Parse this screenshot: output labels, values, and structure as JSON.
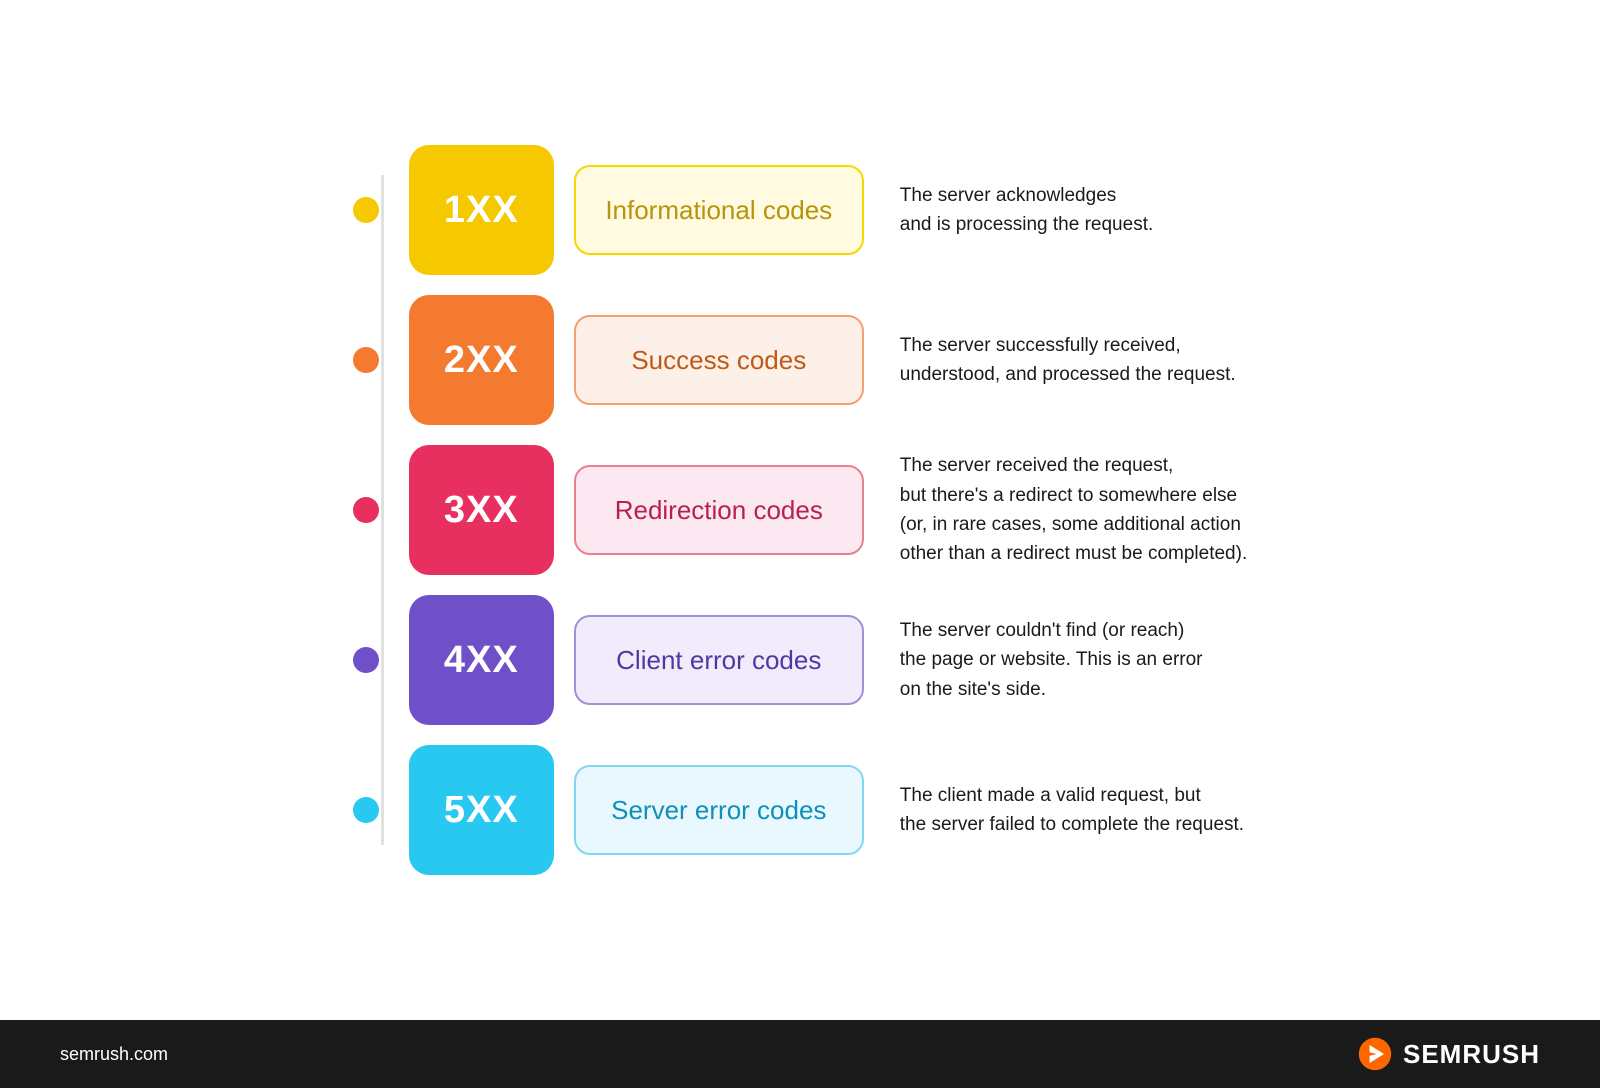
{
  "diagram": {
    "rows": [
      {
        "id": "1xx",
        "dot_color": "#f5c800",
        "code": "1XX",
        "code_bg": "#f5c800",
        "name": "Informational codes",
        "name_bg": "#fffae0",
        "name_border": "#f5d800",
        "name_color": "#b8940a",
        "description": "The server acknowledges\nand is processing the request."
      },
      {
        "id": "2xx",
        "dot_color": "#f47a30",
        "code": "2XX",
        "code_bg": "#f47a30",
        "name": "Success codes",
        "name_bg": "#fdf0e8",
        "name_border": "#f4a070",
        "name_color": "#c05a18",
        "description": "The server successfully received,\nunderstood, and processed the request."
      },
      {
        "id": "3xx",
        "dot_color": "#e83060",
        "code": "3XX",
        "code_bg": "#e83060",
        "name": "Redirection codes",
        "name_bg": "#fce8f0",
        "name_border": "#e88090",
        "name_color": "#b82050",
        "description": "The server received the request,\nbut there's a redirect to somewhere else\n(or, in rare cases, some additional action\nother than a redirect must be completed)."
      },
      {
        "id": "4xx",
        "dot_color": "#7050c8",
        "code": "4XX",
        "code_bg": "#7050c8",
        "name": "Client error codes",
        "name_bg": "#f0ecfc",
        "name_border": "#a090d8",
        "name_color": "#5038a0",
        "description": "The server couldn't find (or reach)\nthe page or website. This is an error\non the site's side."
      },
      {
        "id": "5xx",
        "dot_color": "#28c8f0",
        "code": "5XX",
        "code_bg": "#28c8f0",
        "name": "Server error codes",
        "name_bg": "#e8f8fe",
        "name_border": "#80d8f0",
        "name_color": "#1090b8",
        "description": "The client made a valid request, but\nthe server failed to complete the request."
      }
    ]
  },
  "footer": {
    "url": "semrush.com",
    "brand": "SEMRUSH"
  }
}
